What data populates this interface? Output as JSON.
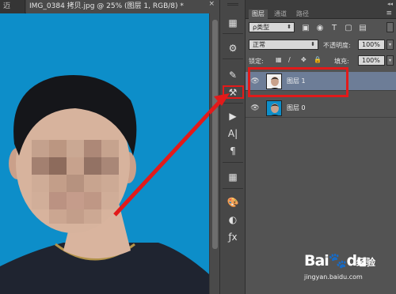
{
  "document": {
    "prev_tab": "迈",
    "active_tab": "IMG_0384 拷贝.jpg @ 25% (图层 1, RGB/8) *",
    "close": "×"
  },
  "tools": [
    {
      "name": "history-icon",
      "glyph": "▦"
    },
    {
      "name": "actions-icon",
      "glyph": "⚙"
    },
    {
      "name": "brush-icon",
      "glyph": "✎"
    },
    {
      "name": "brush-presets-icon",
      "glyph": "⚒"
    },
    {
      "name": "play-icon",
      "glyph": "▶"
    },
    {
      "name": "character-icon",
      "glyph": "A|"
    },
    {
      "name": "paragraph-icon",
      "glyph": "¶"
    },
    {
      "name": "grid-icon",
      "glyph": "▦"
    },
    {
      "name": "palette-icon",
      "glyph": "🎨"
    },
    {
      "name": "color-wheel-icon",
      "glyph": "◐"
    },
    {
      "name": "fx-icon",
      "glyph": "ƒx"
    }
  ],
  "panel": {
    "tabs": [
      {
        "label": "图层",
        "active": true
      },
      {
        "label": "通道",
        "active": false
      },
      {
        "label": "路径",
        "active": false
      }
    ],
    "menu_glyph": "≡",
    "collapse_glyph": "◂◂",
    "filter": {
      "label": "ρ类型",
      "caret": "⬍"
    },
    "filter_icons": [
      "▣",
      "◉",
      "T",
      "▢",
      "▤"
    ],
    "blend_mode": {
      "label": "正常",
      "caret": "⬍"
    },
    "opacity_label": "不透明度:",
    "opacity_value": "100%",
    "lock_label": "锁定:",
    "lock_icons": [
      "▦",
      "∕",
      "✥",
      "🔒"
    ],
    "fill_label": "填充:",
    "fill_value": "100%",
    "layers": [
      {
        "name": "图层 1",
        "selected": true
      },
      {
        "name": "图层 0",
        "selected": false
      }
    ]
  },
  "watermark": {
    "logo": "Bai🐾du",
    "cn": "经验",
    "url": "jingyan.baidu.com"
  },
  "colors": {
    "canvas_bg": "#0d8ec9",
    "annotation_red": "#e21a1a",
    "selected_layer": "#6d7d97"
  }
}
